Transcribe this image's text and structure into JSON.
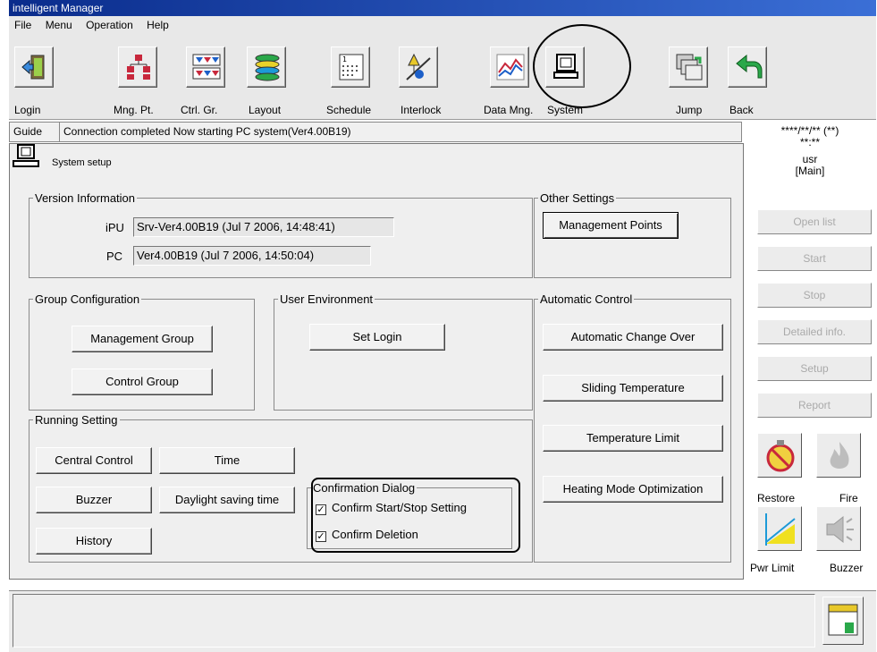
{
  "window": {
    "title": "intelligent Manager"
  },
  "menu": [
    "File",
    "Menu",
    "Operation",
    "Help"
  ],
  "toolbar": {
    "login": "Login",
    "mng_pt": "Mng. Pt.",
    "ctrl_gr": "Ctrl. Gr.",
    "layout": "Layout",
    "schedule": "Schedule",
    "interlock": "Interlock",
    "data_mng": "Data Mng.",
    "system": "System",
    "jump": "Jump",
    "back": "Back"
  },
  "guide": {
    "label": "Guide",
    "text": "Connection completed Now starting PC system(Ver4.00B19)"
  },
  "status_info": {
    "datetime": "****/**/** (**)",
    "time": "**:**",
    "user": "usr",
    "role": "[Main]"
  },
  "panel": {
    "title": "System setup",
    "version": {
      "legend": "Version Information",
      "ipu_label": "iPU",
      "ipu_value": "Srv-Ver4.00B19 (Jul  7 2006, 14:48:41)",
      "pc_label": "PC",
      "pc_value": "Ver4.00B19 (Jul  7 2006, 14:50:04)"
    },
    "other": {
      "legend": "Other Settings",
      "management_points": "Management Points"
    },
    "group_config": {
      "legend": "Group Configuration",
      "management_group": "Management Group",
      "control_group": "Control Group"
    },
    "user_env": {
      "legend": "User Environment",
      "set_login": "Set Login"
    },
    "auto_control": {
      "legend": "Automatic Control",
      "auto_change_over": "Automatic Change Over",
      "sliding_temp": "Sliding Temperature",
      "temp_limit": "Temperature Limit",
      "heating_opt": "Heating Mode Optimization"
    },
    "running": {
      "legend": "Running Setting",
      "central_control": "Central Control",
      "time": "Time",
      "buzzer": "Buzzer",
      "daylight": "Daylight saving time",
      "history": "History"
    },
    "confirm": {
      "legend": "Confirmation Dialog",
      "start_stop": "Confirm Start/Stop Setting",
      "start_stop_checked": true,
      "deletion": "Confirm Deletion",
      "deletion_checked": true
    }
  },
  "side": {
    "open_list": "Open list",
    "start": "Start",
    "stop": "Stop",
    "detailed_info": "Detailed info.",
    "setup": "Setup",
    "report": "Report",
    "restore": "Restore",
    "fire": "Fire",
    "pwr_limit": "Pwr Limit",
    "buzzer": "Buzzer"
  }
}
